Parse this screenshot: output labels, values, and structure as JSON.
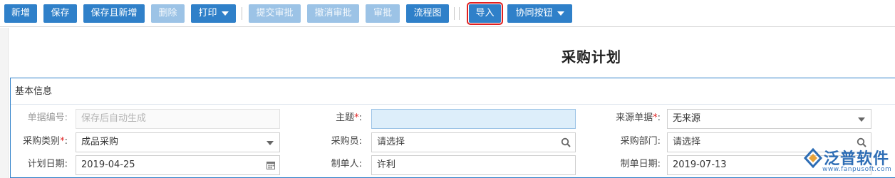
{
  "toolbar": {
    "new": "新增",
    "save": "保存",
    "save_and_new": "保存且新增",
    "delete": "删除",
    "print": "打印",
    "submit_approval": "提交审批",
    "cancel_approval": "撤消审批",
    "approve": "审批",
    "flowchart": "流程图",
    "import": "导入",
    "collab": "协同按钮"
  },
  "page_title": "采购计划",
  "section": {
    "title": "基本信息"
  },
  "form": {
    "doc_no": {
      "label": "单据编号:",
      "placeholder": "保存后自动生成"
    },
    "subject": {
      "label": "主题",
      "value": ""
    },
    "source_doc": {
      "label": "来源单据",
      "value": "无来源"
    },
    "purchase_type": {
      "label": "采购类别",
      "value": "成品采购"
    },
    "buyer": {
      "label": "采购员:",
      "value": "请选择"
    },
    "purchase_dept": {
      "label": "采购部门:",
      "value": "请选择"
    },
    "plan_date": {
      "label": "计划日期:",
      "value": "2019-04-25"
    },
    "creator": {
      "label": "制单人:",
      "value": "许利"
    },
    "create_date": {
      "label": "制单日期:",
      "value": "2019-07-13"
    }
  },
  "logo": {
    "text": "泛普软件",
    "url": "www.fanpusoft.com"
  },
  "colors": {
    "primary": "#2f80c9",
    "disabled": "#9cc3e6",
    "highlight": "#e02020"
  }
}
